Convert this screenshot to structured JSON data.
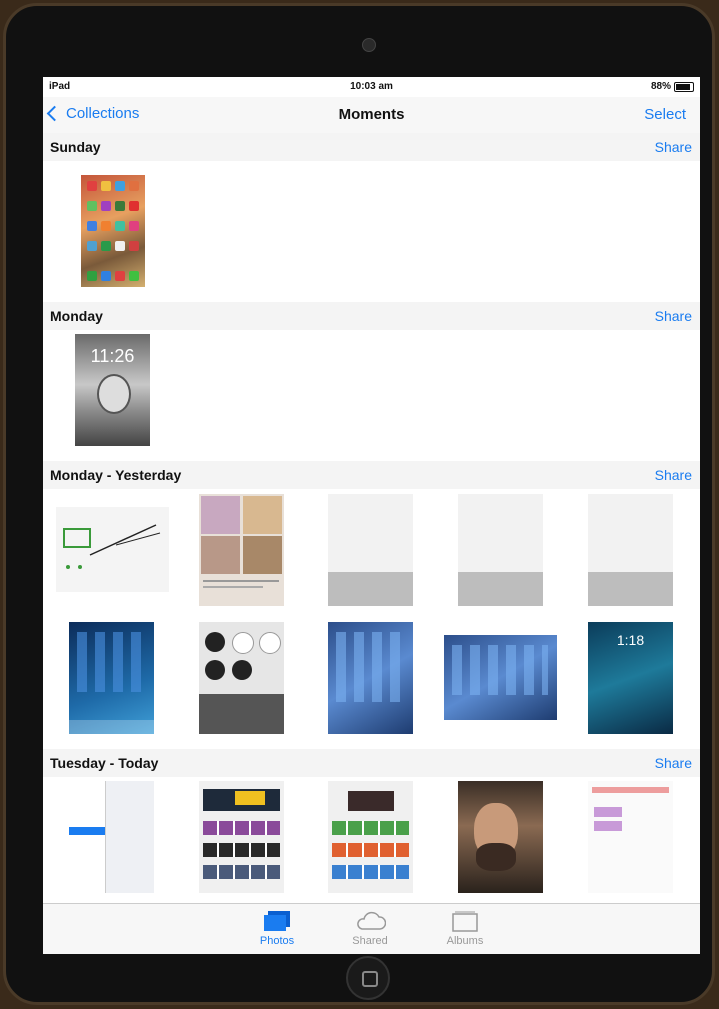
{
  "status_bar": {
    "carrier": "iPad",
    "time": "10:03 am",
    "battery": "88%"
  },
  "nav": {
    "back": "Collections",
    "title": "Moments",
    "select": "Select"
  },
  "sections": [
    {
      "title": "Sunday",
      "share": "Share"
    },
    {
      "title": "Monday",
      "share": "Share"
    },
    {
      "title": "Monday - Yesterday",
      "share": "Share"
    },
    {
      "title": "Tuesday - Today",
      "share": "Share"
    }
  ],
  "thumbs": {
    "sunday": [
      "home-screen-screenshot"
    ],
    "monday": [
      "lock-screen-screenshot"
    ],
    "yesterday": [
      "sketch-screenshot",
      "comic-screenshot",
      "notes-keyboard-screenshot",
      "notes-keyboard-screenshot",
      "notes-keyboard-screenshot",
      "ipad-home-screenshot",
      "world-clock-screenshot",
      "ipad-home-wave-screenshot",
      "ipad-home-landscape-screenshot",
      "ipad-lock-screenshot"
    ],
    "today": [
      "settings-screenshot",
      "app-store-screenshot",
      "app-store-games-screenshot",
      "selfie-photo",
      "calendar-screenshot"
    ]
  },
  "lock_time": "11:26",
  "ipad_lock_time": "1:18",
  "tabs": [
    {
      "label": "Photos",
      "icon": "photos-icon",
      "active": true
    },
    {
      "label": "Shared",
      "icon": "cloud-icon",
      "active": false
    },
    {
      "label": "Albums",
      "icon": "albums-icon",
      "active": false
    }
  ],
  "colors": {
    "accent": "#1a7cf0",
    "header_bg": "#f4f4f4"
  }
}
